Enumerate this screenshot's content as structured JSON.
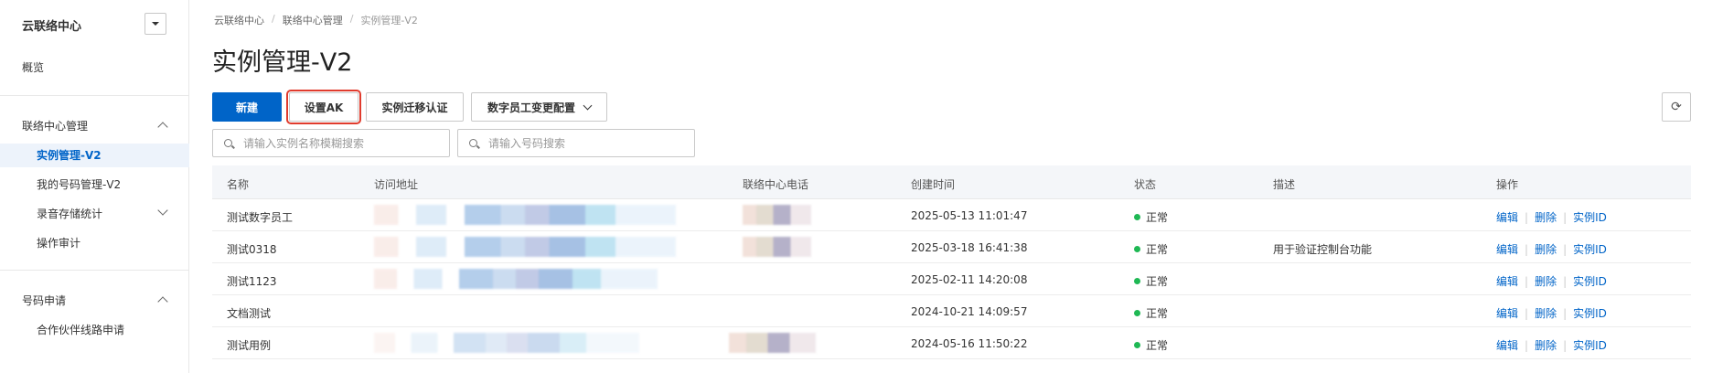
{
  "sidebar": {
    "title": "云联络中心",
    "overview": "概览",
    "group1": {
      "label": "联络中心管理",
      "items": [
        "实例管理-V2",
        "我的号码管理-V2",
        "录音存储统计",
        "操作审计"
      ]
    },
    "group2": {
      "label": "号码申请",
      "items": [
        "合作伙伴线路申请"
      ]
    }
  },
  "breadcrumb": [
    "云联络中心",
    "联络中心管理",
    "实例管理-V2"
  ],
  "page_title": "实例管理-V2",
  "toolbar": {
    "new": "新建",
    "set_ak": "设置AK",
    "migrate": "实例迁移认证",
    "digital_config": "数字员工变更配置"
  },
  "search": {
    "instance_placeholder": "请输入实例名称模糊搜索",
    "number_placeholder": "请输入号码搜索"
  },
  "table": {
    "headers": [
      "名称",
      "访问地址",
      "联络中心电话",
      "创建时间",
      "状态",
      "描述",
      "操作"
    ],
    "rows": [
      {
        "name": "测试数字员工",
        "created": "2025-05-13 11:01:47",
        "status": "正常",
        "desc": ""
      },
      {
        "name": "测试0318",
        "created": "2025-03-18 16:41:38",
        "status": "正常",
        "desc": "用于验证控制台功能"
      },
      {
        "name": "测试1123",
        "created": "2025-02-11 14:20:08",
        "status": "正常",
        "desc": ""
      },
      {
        "name": "文档测试",
        "created": "2024-10-21 14:09:57",
        "status": "正常",
        "desc": ""
      },
      {
        "name": "测试用例",
        "created": "2024-05-16 11:50:22",
        "status": "正常",
        "desc": ""
      }
    ],
    "ops": {
      "edit": "编辑",
      "delete": "删除",
      "instance_id": "实例ID"
    }
  },
  "colors": {
    "accent": "#0064c8",
    "status_ok": "#1fb854",
    "highlight": "#e03b2d"
  }
}
